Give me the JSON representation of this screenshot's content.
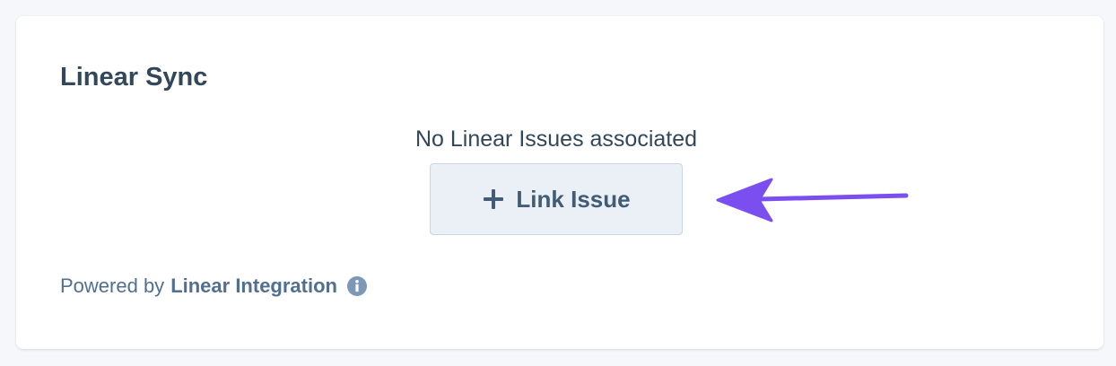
{
  "card": {
    "title": "Linear Sync",
    "empty_message": "No Linear Issues associated",
    "link_button": {
      "icon": "plus-icon",
      "label": "Link Issue"
    },
    "annotation_arrow_color": "#7b4ef0",
    "footer": {
      "prefix": "Powered by",
      "link_label": "Linear Integration",
      "icon": "info-icon"
    }
  },
  "colors": {
    "page_background": "#f5f7fa",
    "card_background": "#ffffff",
    "heading_text": "#33475b",
    "button_background": "#eaf0f6",
    "button_border": "#cbd6e2",
    "secondary_text": "#516f90"
  }
}
